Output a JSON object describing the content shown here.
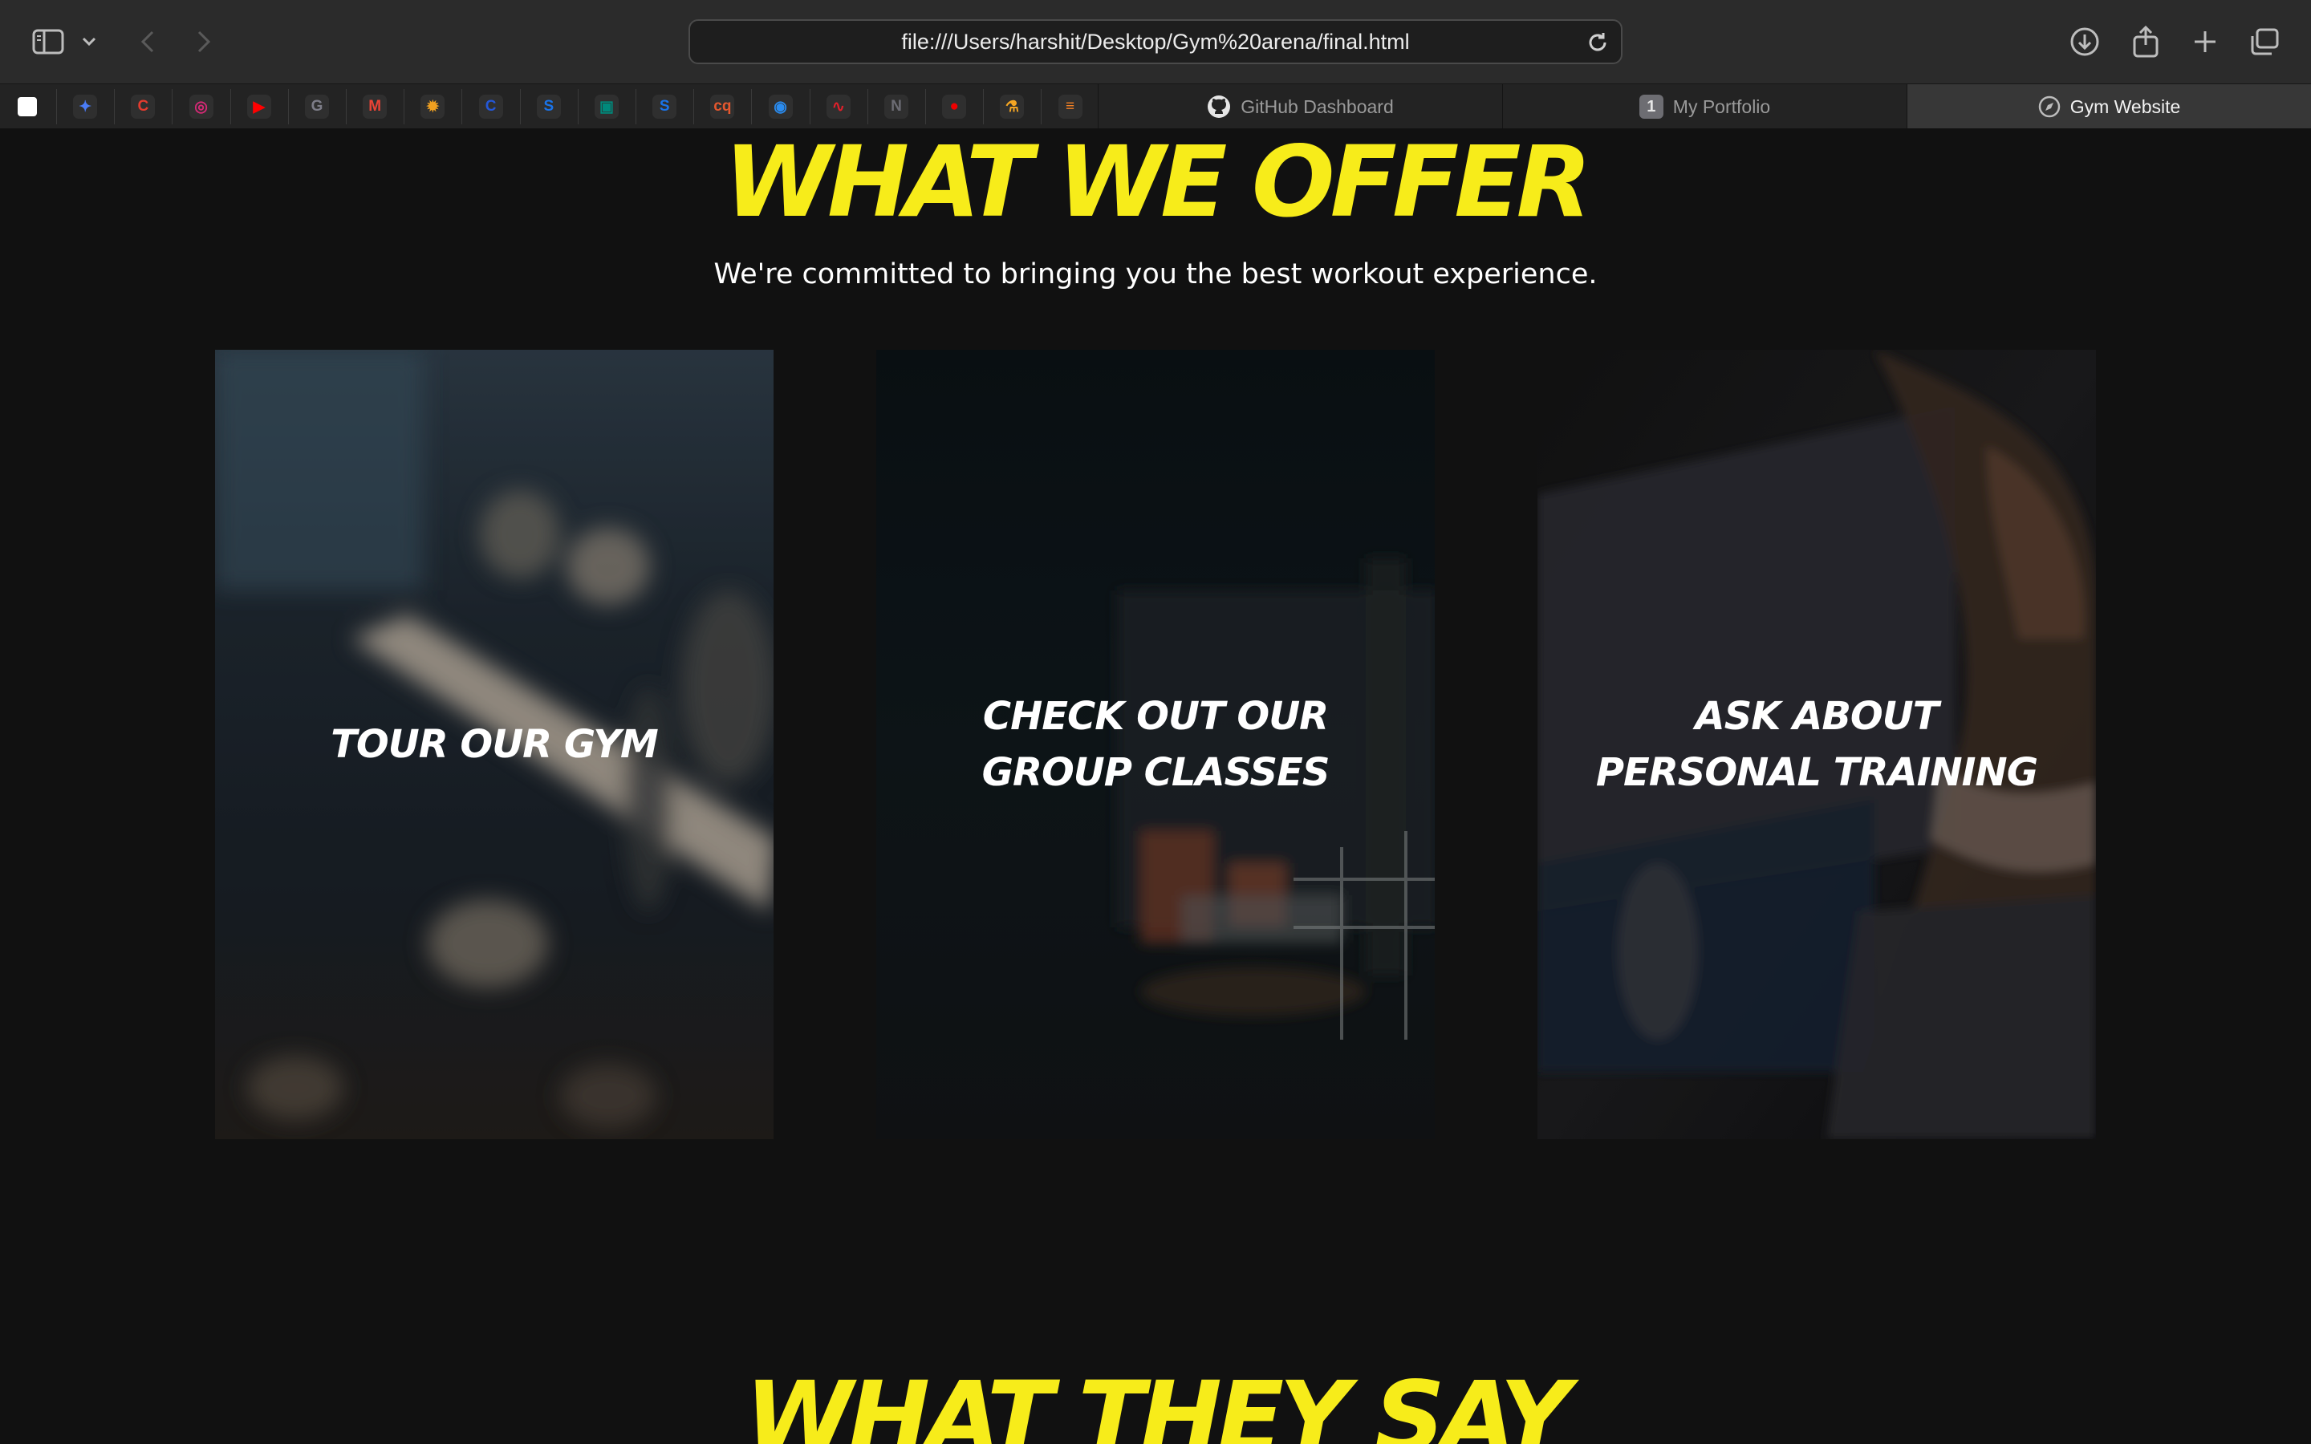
{
  "browser": {
    "url": "file:///Users/harshit/Desktop/Gym%20arena/final.html",
    "tabs": [
      {
        "label": "GitHub Dashboard",
        "icon": "github-icon",
        "active": false
      },
      {
        "label": "My Portfolio",
        "icon": "tab-number-icon",
        "badge": "1",
        "active": false
      },
      {
        "label": "Gym Website",
        "icon": "compass-icon",
        "active": true
      }
    ],
    "pinned": [
      {
        "name": "chatgpt-icon",
        "glyph": "",
        "color": "#ffffff"
      },
      {
        "name": "gemini-icon",
        "glyph": "✦",
        "color": "#4a7cf7"
      },
      {
        "name": "chrome-icon",
        "glyph": "C",
        "color": "#e33b2e"
      },
      {
        "name": "instagram-icon",
        "glyph": "◎",
        "color": "#d62976"
      },
      {
        "name": "youtube-icon",
        "glyph": "▶",
        "color": "#ff0000"
      },
      {
        "name": "g-icon",
        "glyph": "G",
        "color": "#7d7d88"
      },
      {
        "name": "gmail-icon",
        "glyph": "M",
        "color": "#ea4335"
      },
      {
        "name": "settings-sun-icon",
        "glyph": "✹",
        "color": "#f0a020"
      },
      {
        "name": "c-icon",
        "glyph": "C",
        "color": "#2457d6"
      },
      {
        "name": "s-icon",
        "glyph": "S",
        "color": "#1a73e8"
      },
      {
        "name": "meet-icon",
        "glyph": "▣",
        "color": "#00897b"
      },
      {
        "name": "s-blue-icon",
        "glyph": "S",
        "color": "#1a73e8"
      },
      {
        "name": "cq-icon",
        "glyph": "cq",
        "color": "#e4572e"
      },
      {
        "name": "messenger-icon",
        "glyph": "◉",
        "color": "#2a8cf0"
      },
      {
        "name": "rss-icon",
        "glyph": "∿",
        "color": "#e0202a"
      },
      {
        "name": "notion-icon",
        "glyph": "N",
        "color": "#6c6c74"
      },
      {
        "name": "redhat-icon",
        "glyph": "●",
        "color": "#ee0000"
      },
      {
        "name": "flask-icon",
        "glyph": "⚗",
        "color": "#f5a623"
      },
      {
        "name": "stack-icon",
        "glyph": "≡",
        "color": "#f48024"
      }
    ]
  },
  "offer": {
    "title": "WHAT WE OFFER",
    "subtitle": "We're committed to bringing you the best workout experience.",
    "cards": [
      {
        "label": "TOUR OUR GYM"
      },
      {
        "label": "CHECK OUT OUR\nGROUP CLASSES"
      },
      {
        "label": "ASK ABOUT\nPERSONAL TRAINING"
      }
    ]
  },
  "testimonials": {
    "title": "WHAT THEY SAY"
  },
  "colors": {
    "accent": "#f7ec1a",
    "background": "#111111",
    "text": "#ffffff"
  }
}
